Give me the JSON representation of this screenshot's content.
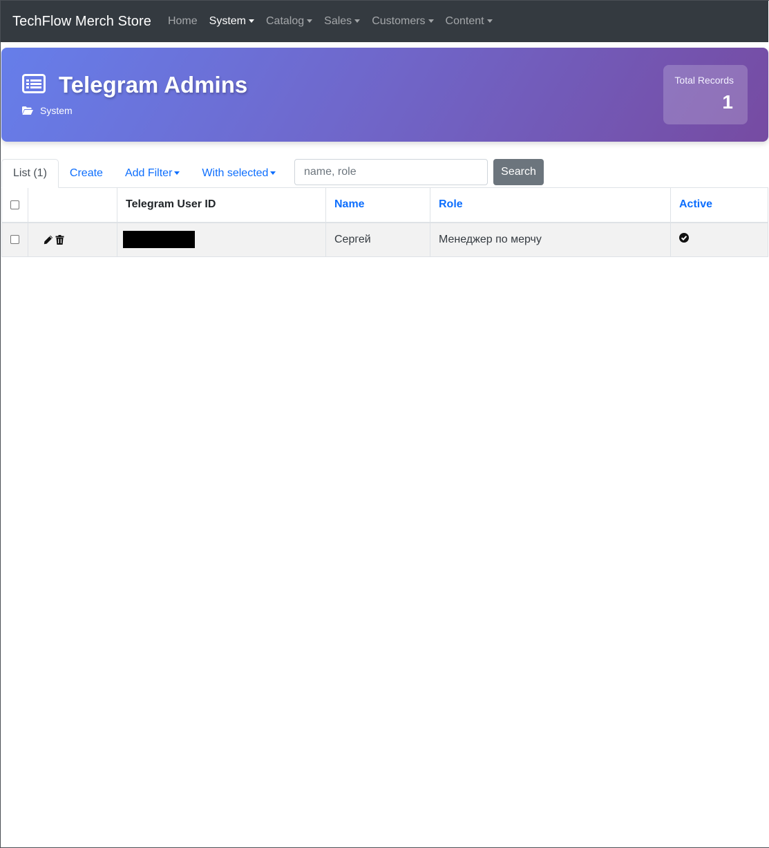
{
  "navbar": {
    "brand": "TechFlow Merch Store",
    "items": [
      {
        "label": "Home"
      },
      {
        "label": "System"
      },
      {
        "label": "Catalog"
      },
      {
        "label": "Sales"
      },
      {
        "label": "Customers"
      },
      {
        "label": "Content"
      }
    ]
  },
  "header": {
    "title": "Telegram Admins",
    "breadcrumb": "System",
    "stat_label": "Total Records",
    "stat_value": "1",
    "gradient_start": "#667eea",
    "gradient_end": "#764ba2"
  },
  "toolbar": {
    "tabs": [
      {
        "label": "List (1)"
      },
      {
        "label": "Create"
      },
      {
        "label": "Add Filter"
      },
      {
        "label": "With selected"
      }
    ],
    "search_placeholder": "name, role",
    "search_value": "",
    "search_button": "Search"
  },
  "table": {
    "columns": [
      "Telegram User ID",
      "Name",
      "Role",
      "Active"
    ],
    "rows": [
      {
        "telegram_user_id": "",
        "name": "Сергей",
        "role": "Менеджер по мерчу",
        "active": true
      }
    ]
  },
  "icons": {
    "banner": "list-alt-icon",
    "breadcrumb": "folder-open-icon",
    "edit": "pencil-icon",
    "delete": "trash-icon",
    "active": "check-circle-icon"
  },
  "colors": {
    "navbar_bg": "#343a40",
    "link": "#0d6efd",
    "button_secondary": "#6c757d"
  }
}
